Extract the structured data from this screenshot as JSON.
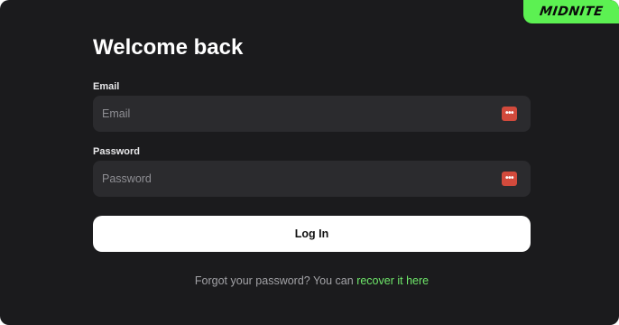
{
  "brand": {
    "logo_text": "MIDNITE",
    "accent_color": "#5cf152"
  },
  "form": {
    "title": "Welcome back",
    "email": {
      "label": "Email",
      "placeholder": "Email",
      "value": ""
    },
    "password": {
      "label": "Password",
      "placeholder": "Password",
      "value": ""
    },
    "password_manager_icon": "password-manager-icon",
    "password_manager_glyph": "•••",
    "login_label": "Log In",
    "forgot_prefix": "Forgot your password? You can ",
    "recover_link": "recover it here"
  }
}
